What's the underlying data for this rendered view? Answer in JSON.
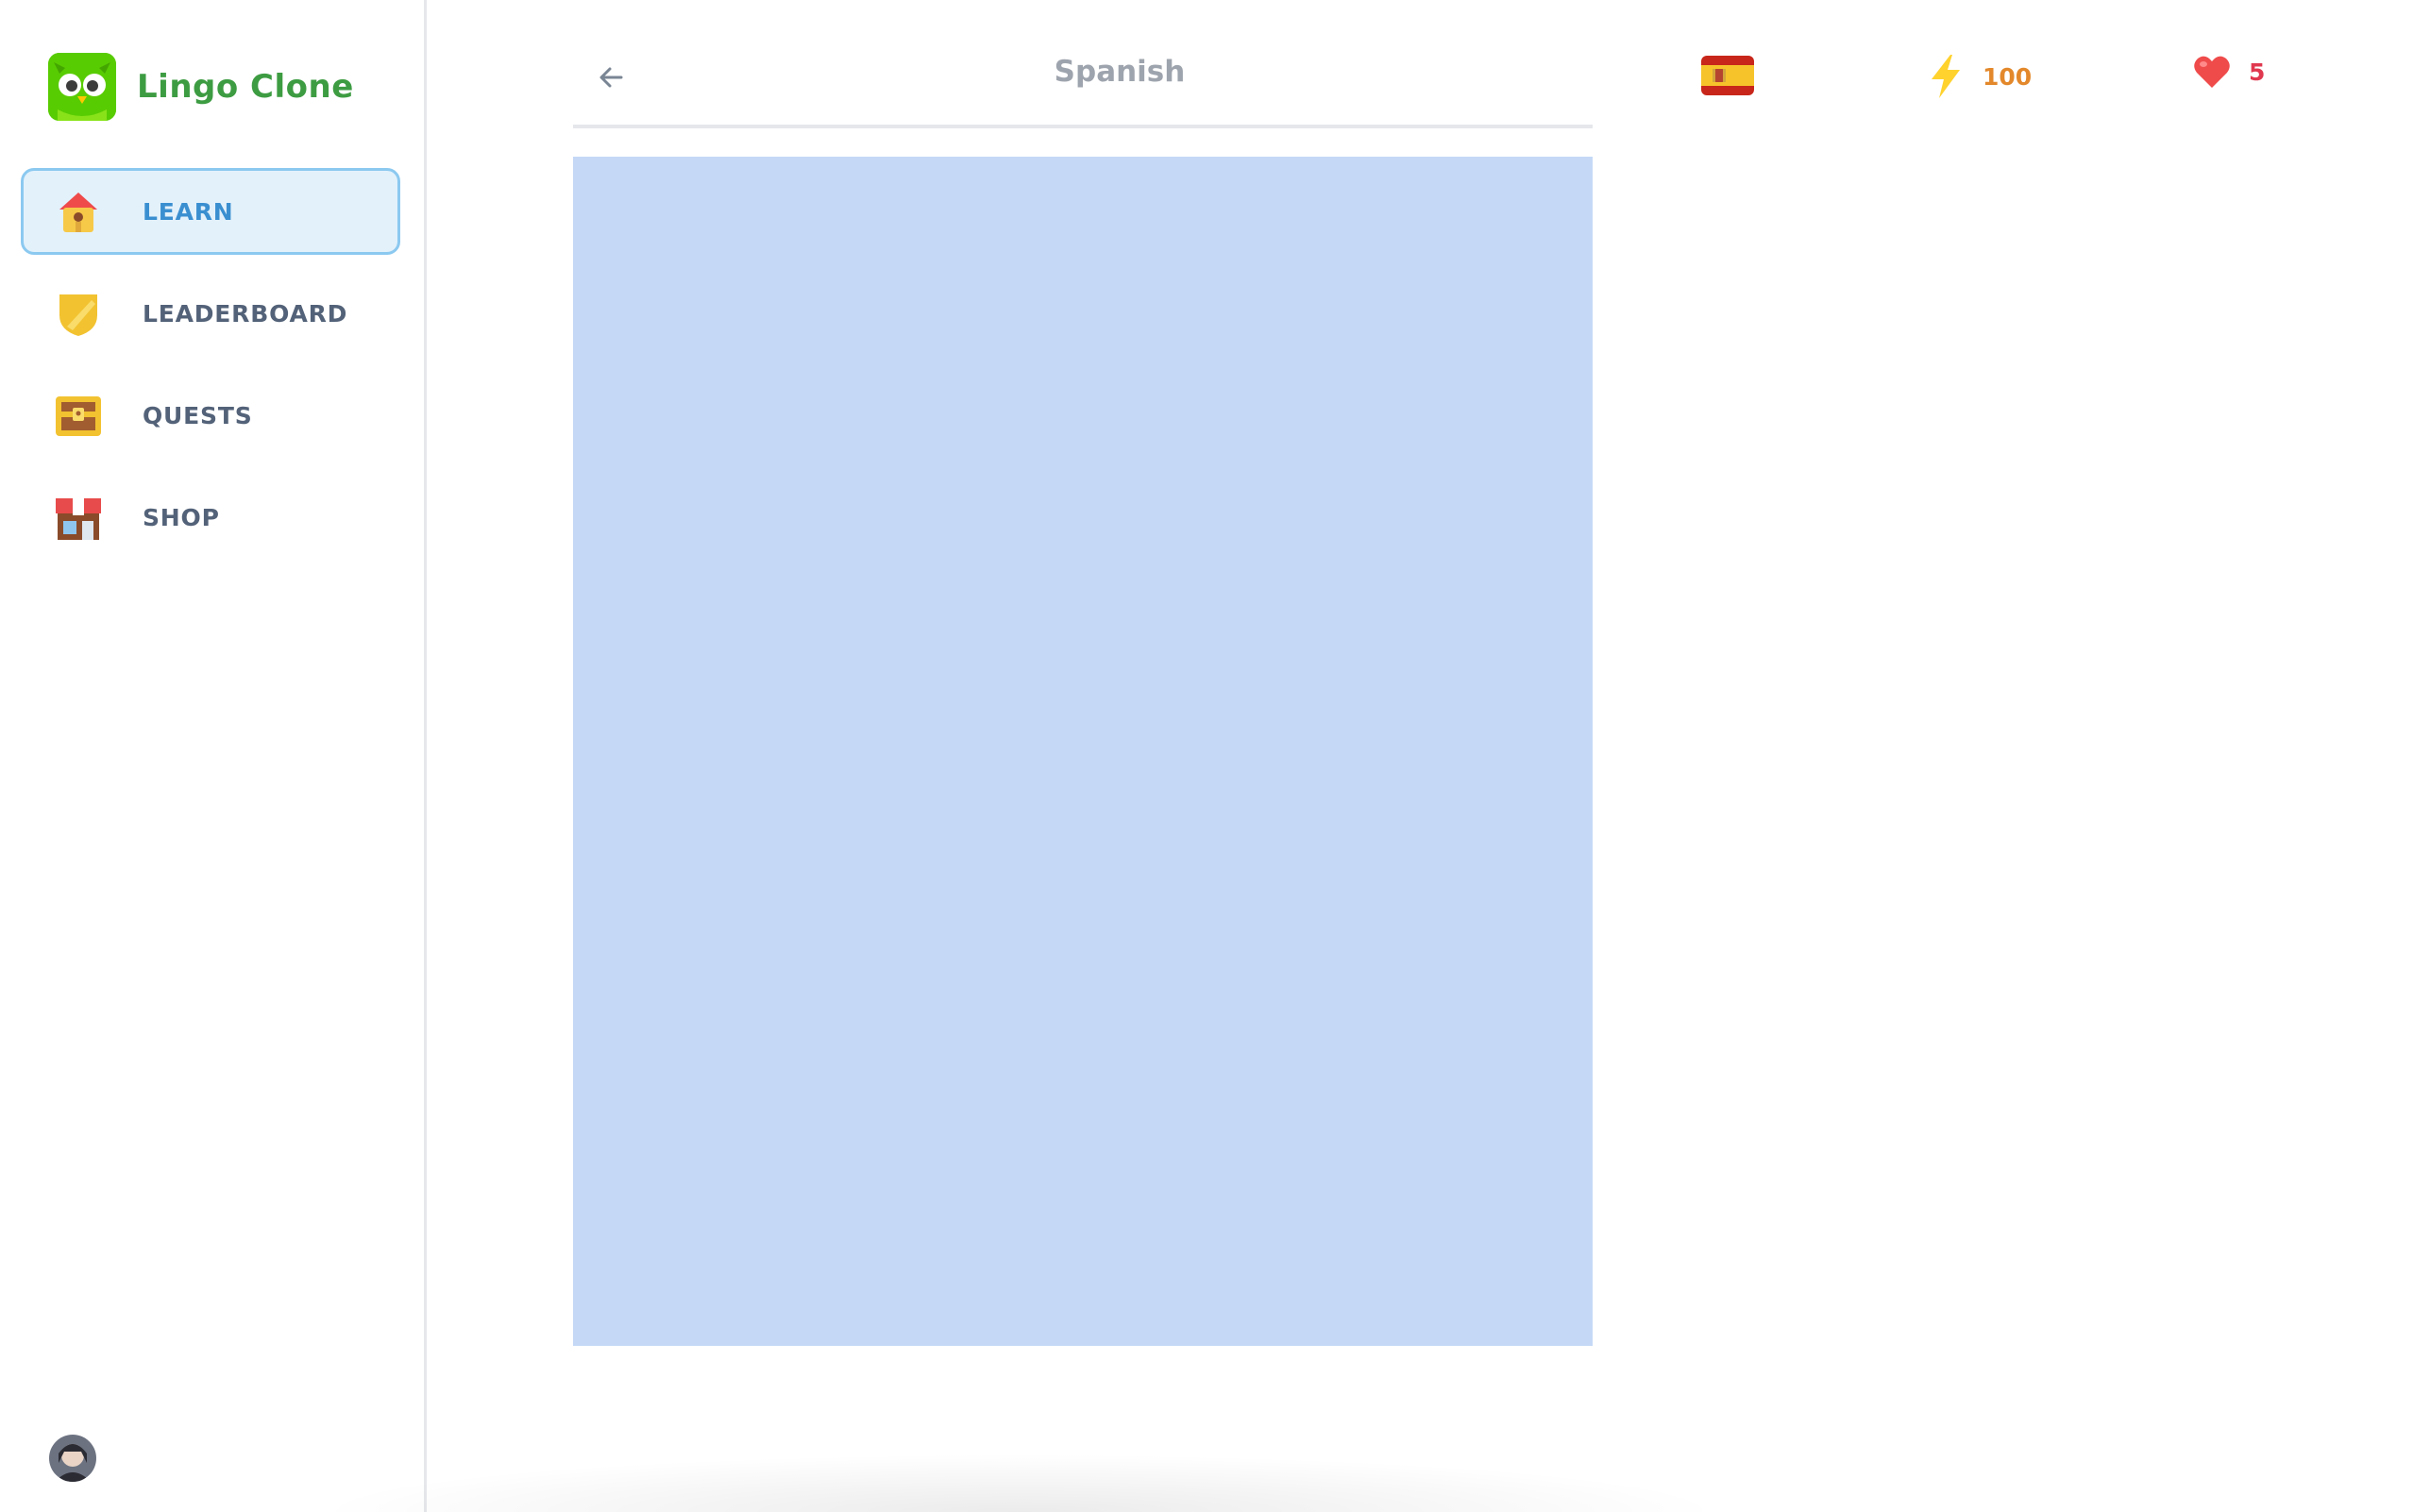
{
  "brand": {
    "name": "Lingo Clone",
    "logo_icon": "owl-logo-icon"
  },
  "sidebar": {
    "items": [
      {
        "label": "LEARN",
        "icon": "house-icon",
        "active": true
      },
      {
        "label": "LEADERBOARD",
        "icon": "shield-icon",
        "active": false
      },
      {
        "label": "QUESTS",
        "icon": "treasure-chest-icon",
        "active": false
      },
      {
        "label": "SHOP",
        "icon": "store-icon",
        "active": false
      }
    ]
  },
  "header": {
    "title": "Spanish",
    "back_icon": "arrow-left-icon"
  },
  "stats": {
    "language_flag": "spain-flag-icon",
    "points": "100",
    "points_icon": "lightning-icon",
    "hearts": "5",
    "hearts_icon": "heart-icon"
  },
  "colors": {
    "brand_green": "#3d9c42",
    "active_nav_bg": "#e3f1fb",
    "active_nav_border": "#8cc9f0",
    "active_nav_text": "#3a8fd0",
    "placeholder_block": "#c5d9f7",
    "points": "#e3882b",
    "hearts": "#e0384f"
  }
}
